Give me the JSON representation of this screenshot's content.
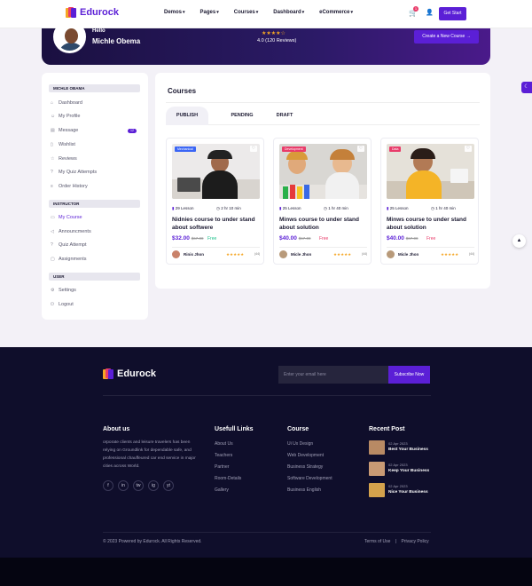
{
  "header": {
    "brand": "Edurock",
    "nav": [
      {
        "label": "Demos"
      },
      {
        "label": "Pages"
      },
      {
        "label": "Courses"
      },
      {
        "label": "Dashboard"
      },
      {
        "label": "eCommerce"
      }
    ],
    "cart_count": "1",
    "cta": "Get Start"
  },
  "banner": {
    "greeting": "Hello",
    "name": "Michle Obema",
    "stars": "★★★★☆",
    "rating": "4.0 (120 Reviews)",
    "create_button": "Create a New Course →"
  },
  "sidebar": {
    "section_user": "MICHLE OBAMA",
    "items_user": [
      {
        "label": "Dashboard",
        "icon": "home-icon"
      },
      {
        "label": "My Profile",
        "icon": "user-icon"
      },
      {
        "label": "Message",
        "icon": "book-icon",
        "badge": "12"
      },
      {
        "label": "Wishlist",
        "icon": "bookmark-icon"
      },
      {
        "label": "Reviews",
        "icon": "star-icon"
      },
      {
        "label": "My Quiz Attempts",
        "icon": "help-icon"
      },
      {
        "label": "Order History",
        "icon": "list-icon"
      }
    ],
    "section_instructor": "INSTRUCTOR",
    "items_instructor": [
      {
        "label": "My Course",
        "icon": "monitor-icon"
      },
      {
        "label": "Announcments",
        "icon": "megaphone-icon"
      },
      {
        "label": "Quiz Attempt",
        "icon": "help-icon"
      },
      {
        "label": "Assignments",
        "icon": "assignment-icon"
      }
    ],
    "section_user2": "USER",
    "items_user2": [
      {
        "label": "Settings",
        "icon": "gear-icon"
      },
      {
        "label": "Logout",
        "icon": "logout-icon"
      }
    ]
  },
  "main": {
    "title": "Courses",
    "tabs": [
      "PUBLISH",
      "PENDING",
      "DRAFT"
    ],
    "cards": [
      {
        "tag": "Mechanical",
        "tag_color": "#3b66f5",
        "lessons": "29 Lesson",
        "duration": "2 hr 10 min",
        "title": "Nidnies course to under stand about softwere",
        "price": "$32.00",
        "old_price": "$67.00",
        "price_badge": "Free",
        "badge_color": "#1ec28b",
        "instructor": "Rinis Jhon",
        "stars": "★★★★★",
        "reviews": "(44)"
      },
      {
        "tag": "Development",
        "tag_color": "#e93c6a",
        "lessons": "25 Lesson",
        "duration": "1 hr 40 min",
        "title": "Minws course to under stand about solution",
        "price": "$40.00",
        "old_price": "$67.00",
        "price_badge": "Free",
        "badge_color": "#e93c6a",
        "instructor": "Micle Jhon",
        "stars": "★★★★★",
        "reviews": "(44)"
      },
      {
        "tag": "Data",
        "tag_color": "#e93c6a",
        "lessons": "25 Lesson",
        "duration": "1 hr 40 min",
        "title": "Minws course to under stand about solution",
        "price": "$40.00",
        "old_price": "$67.00",
        "price_badge": "Free",
        "badge_color": "#e93c6a",
        "instructor": "Micle Jhon",
        "stars": "★★★★★",
        "reviews": "(44)"
      }
    ]
  },
  "footer": {
    "brand": "Edurock",
    "subscribe_placeholder": "Enter your email here",
    "subscribe_button": "Subscribe Now",
    "about_title": "About us",
    "about_text": "orporate clients and leisure travelers has been relying on Groundlink for dependable safe, and professional chauffeured car end service in major cities across World.",
    "social": [
      "f",
      "in",
      "tw",
      "ig",
      "yt"
    ],
    "links_title": "Usefull Links",
    "links": [
      "About Us",
      "Teachers",
      "Partner",
      "Room-Details",
      "Gallery"
    ],
    "course_title": "Course",
    "courses": [
      "Ui Ux Design",
      "Web Development",
      "Business Strategy",
      "Software Development",
      "Business English"
    ],
    "recent_title": "Recent Post",
    "posts": [
      {
        "date": "02 Apr 2023",
        "title": "Best Your Business"
      },
      {
        "date": "02 Apr 2023",
        "title": "Keep Your Business"
      },
      {
        "date": "02 Apr 2023",
        "title": "Nice Your Business"
      }
    ],
    "copyright": "© 2023 Powered by Edurock. All Rights Reserved.",
    "terms": "Terms of Use",
    "sep": "|",
    "privacy": "Privacy Policy"
  }
}
